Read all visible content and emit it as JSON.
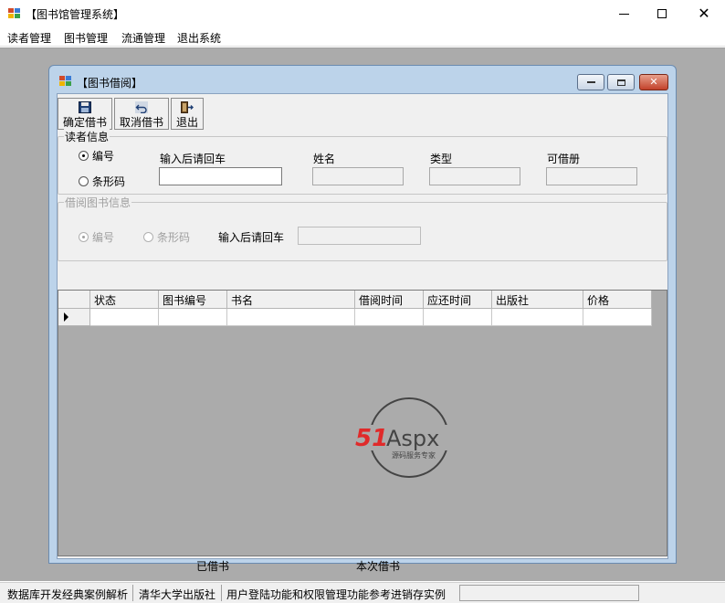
{
  "window": {
    "title": "【图书馆管理系统】",
    "minimize_icon": "minimize-icon",
    "maximize_icon": "maximize-icon",
    "close_glyph": "✕"
  },
  "menu": {
    "items": [
      {
        "label": "读者管理"
      },
      {
        "label": "图书管理"
      },
      {
        "label": "流通管理"
      },
      {
        "label": "退出系统"
      }
    ]
  },
  "child_window": {
    "title": "【图书借阅】",
    "close_glyph": "✕"
  },
  "toolbar": {
    "buttons": [
      {
        "label": "确定借书",
        "icon": "save-icon"
      },
      {
        "label": "取消借书",
        "icon": "undo-icon"
      },
      {
        "label": "退出",
        "icon": "exit-icon"
      }
    ]
  },
  "reader_info": {
    "group_title": "读者信息",
    "radio_id": "编号",
    "radio_barcode": "条形码",
    "selected": "编号",
    "input_label": "输入后请回车",
    "input_value": "",
    "name_label": "姓名",
    "name_value": "",
    "type_label": "类型",
    "type_value": "",
    "quota_label": "可借册",
    "quota_value": ""
  },
  "book_info": {
    "group_title": "借阅图书信息",
    "radio_id": "编号",
    "radio_barcode": "条形码",
    "selected": "编号",
    "input_label": "输入后请回车",
    "input_value": ""
  },
  "grid": {
    "columns": [
      "状态",
      "图书编号",
      "书名",
      "借阅时间",
      "应还时间",
      "出版社",
      "价格"
    ],
    "rows": [
      [
        "",
        "",
        "",
        "",
        "",
        "",
        ""
      ]
    ]
  },
  "watermark": {
    "text": "51Aspx",
    "subtitle": "源码服务专家",
    "colors": {
      "red": "#e02a2a",
      "dark": "#444444",
      "green": "#2fa82f"
    }
  },
  "footer": {
    "borrowed_label": "已借书",
    "this_time_label": "本次借书"
  },
  "statusbar": {
    "segments": [
      "数据库开发经典案例解析",
      "清华大学出版社",
      "用户登陆功能和权限管理功能参考进销存实例"
    ]
  }
}
